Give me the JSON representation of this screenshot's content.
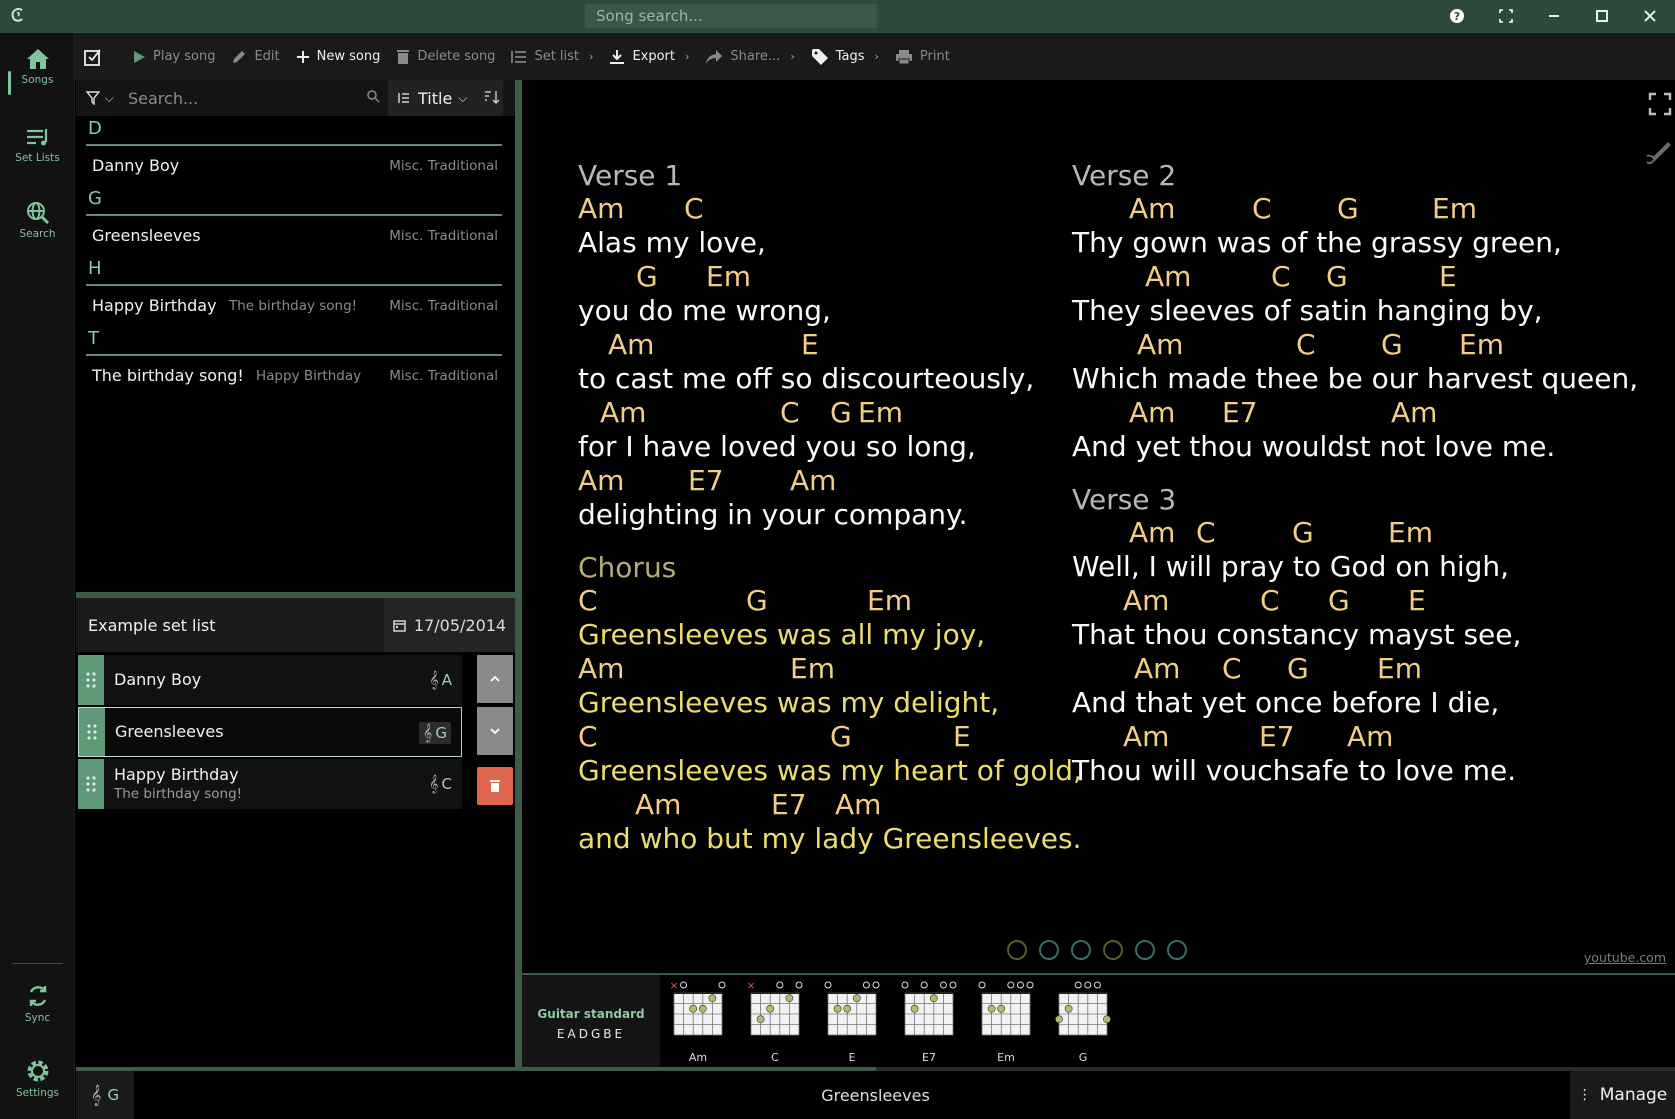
{
  "titlebar": {
    "search_placeholder": "Song search..."
  },
  "rail": {
    "songs": "Songs",
    "set_lists": "Set Lists",
    "search": "Search",
    "sync": "Sync",
    "settings": "Settings"
  },
  "toolbar": {
    "play": "Play song",
    "edit": "Edit",
    "new_song": "New song",
    "delete": "Delete song",
    "set_list": "Set list",
    "export": "Export",
    "share": "Share...",
    "tags": "Tags",
    "print": "Print"
  },
  "song_list": {
    "search_placeholder": "Search...",
    "sort_field": "Title",
    "letters": [
      "D",
      "G",
      "H",
      "T"
    ],
    "songs": [
      {
        "title": "Danny Boy",
        "subtitle": "",
        "artist": "Misc. Traditional"
      },
      {
        "title": "Greensleeves",
        "subtitle": "",
        "artist": "Misc. Traditional"
      },
      {
        "title": "Happy Birthday",
        "subtitle": "The birthday song!",
        "artist": "Misc. Traditional"
      },
      {
        "title": "The birthday song!",
        "subtitle": "Happy Birthday",
        "artist": "Misc. Traditional"
      }
    ]
  },
  "set_list": {
    "name": "Example set list",
    "date": "17/05/2014",
    "items": [
      {
        "title": "Danny Boy",
        "subtitle": "",
        "key": "A"
      },
      {
        "title": "Greensleeves",
        "subtitle": "",
        "key": "G"
      },
      {
        "title": "Happy Birthday",
        "subtitle": "The birthday song!",
        "key": "C"
      }
    ]
  },
  "song": {
    "left_column": [
      {
        "title": "Verse 1",
        "lines": [
          {
            "chords": [
              "Am",
              "C"
            ],
            "lyric": "Alas my love,"
          },
          {
            "chords": [
              "G",
              "Em"
            ],
            "lyric": "you do me wrong,"
          },
          {
            "chords": [
              "Am",
              "E"
            ],
            "lyric": "to cast me off so discourteously,"
          },
          {
            "chords": [
              "Am",
              "C",
              "G",
              "Em"
            ],
            "lyric": "for I have loved you so long,"
          },
          {
            "chords": [
              "Am",
              "E7",
              "Am"
            ],
            "lyric": "delighting in your company."
          }
        ]
      },
      {
        "title": "Chorus",
        "lines": [
          {
            "chords": [
              "C",
              "G",
              "Em"
            ],
            "lyric": "Greensleeves was all my joy,"
          },
          {
            "chords": [
              "Am",
              "Em"
            ],
            "lyric": "Greensleeves was my delight,"
          },
          {
            "chords": [
              "C",
              "G",
              "E"
            ],
            "lyric": "Greensleeves was my heart of gold,"
          },
          {
            "chords": [
              "Am",
              "E7",
              "Am"
            ],
            "lyric": "and who but my lady Greensleeves."
          }
        ]
      }
    ],
    "right_column": [
      {
        "title": "Verse 2",
        "lines": [
          {
            "chords": [
              "Am",
              "C",
              "G",
              "Em"
            ],
            "lyric": "Thy gown was of the grassy green,"
          },
          {
            "chords": [
              "Am",
              "C",
              "G",
              "E"
            ],
            "lyric": "They sleeves of satin hanging by,"
          },
          {
            "chords": [
              "Am",
              "C",
              "G",
              "Em"
            ],
            "lyric": "Which made thee be our harvest queen,"
          },
          {
            "chords": [
              "Am",
              "E7",
              "Am"
            ],
            "lyric": "And yet thou wouldst not love me."
          }
        ]
      },
      {
        "title": "Verse 3",
        "lines": [
          {
            "chords": [
              "Am",
              "C",
              "G",
              "Em"
            ],
            "lyric": "Well, I will pray to God on high,"
          },
          {
            "chords": [
              "Am",
              "C",
              "G",
              "E"
            ],
            "lyric": "That thou constancy mayst see,"
          },
          {
            "chords": [
              "Am",
              "C",
              "G",
              "Em"
            ],
            "lyric": "And that yet once before I die,"
          },
          {
            "chords": [
              "Am",
              "E7",
              "Am"
            ],
            "lyric": "Thou will vouchsafe to love me."
          }
        ]
      }
    ],
    "source_link": "youtube.com"
  },
  "chord_strip": {
    "tuning_name": "Guitar standard",
    "tuning_strings": "EADGBE",
    "chords": [
      "Am",
      "C",
      "E",
      "E7",
      "Em",
      "G"
    ]
  },
  "bottom": {
    "key": "G",
    "current_song": "Greensleeves",
    "manage": "Manage",
    "progress": 0.5
  },
  "colors": {
    "accent": "#5e9877",
    "titlebar": "#2e4a3b",
    "chord": "#f3cd86",
    "chorus_lyric": "#ecdc6c",
    "delete": "#e0654f"
  }
}
